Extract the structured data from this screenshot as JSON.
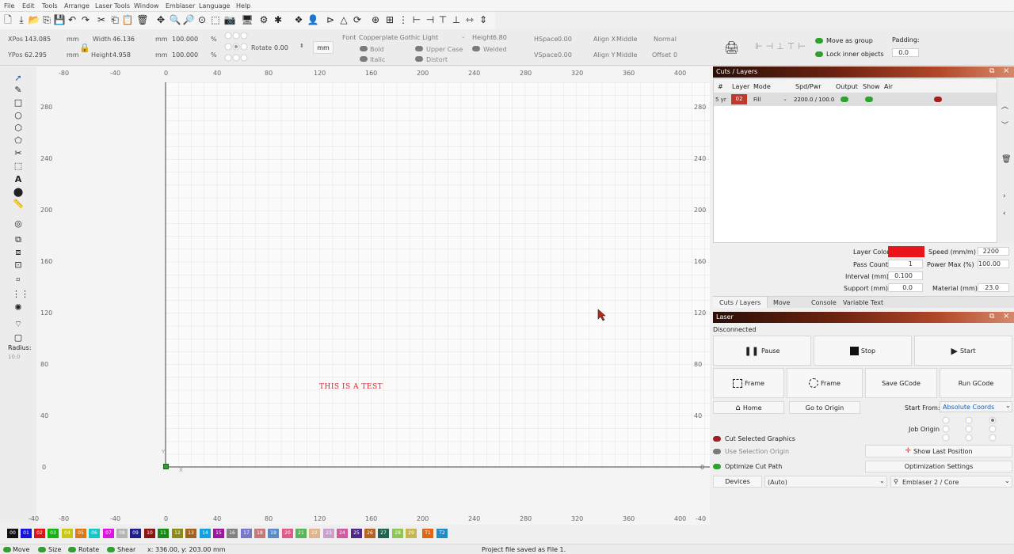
{
  "menu": [
    "File",
    "Edit",
    "Tools",
    "Arrange",
    "Laser Tools",
    "Window",
    "Emblaser",
    "Language",
    "Help"
  ],
  "props": {
    "xpos_label": "XPos",
    "xpos": "143.085",
    "ypos_label": "YPos",
    "ypos": "62.295",
    "unit": "mm",
    "width_label": "Width",
    "width": "46.136",
    "height_label": "Height",
    "height": "4.958",
    "scale_w": "100.000",
    "scale_h": "100.000",
    "pct": "%",
    "rotate_label": "Rotate",
    "rotate": "0.00",
    "mm_button": "mm",
    "font_label": "Font",
    "font_name": "Copperplate Gothic Light",
    "font_height_label": "Height",
    "font_height": "6.80",
    "bold": "Bold",
    "italic": "Italic",
    "upper_case": "Upper Case",
    "distort": "Distort",
    "welded": "Welded",
    "hspace_label": "HSpace",
    "hspace": "0.00",
    "vspace_label": "VSpace",
    "vspace": "0.00",
    "alignx_label": "Align X",
    "alignx": "Middle",
    "aligny_label": "Align Y",
    "aligny": "Middle",
    "mode": "Normal",
    "offset_label": "Offset",
    "offset": "0"
  },
  "rightbar": {
    "move_as_group": "Move as group",
    "lock_inner": "Lock inner objects",
    "padding_label": "Padding:",
    "padding": "0.0"
  },
  "tools": {
    "radius_label": "Radius:",
    "radius": "10.0"
  },
  "rulers": {
    "top": [
      "-80",
      "-40",
      "0",
      "40",
      "80",
      "120",
      "160",
      "200",
      "240",
      "280",
      "320",
      "360",
      "400"
    ],
    "left": [
      "280",
      "240",
      "200",
      "160",
      "120",
      "80",
      "40",
      "0",
      "-40"
    ]
  },
  "canvas": {
    "text": "THIS IS A TEST",
    "x_marker": "X",
    "y_marker": "Y"
  },
  "cuts": {
    "title": "Cuts / Layers",
    "headers": [
      "#",
      "Layer",
      "Mode",
      "Spd/Pwr",
      "Output",
      "Show",
      "Air"
    ],
    "row": {
      "num": "5 yr",
      "layer": "02",
      "mode": "Fill",
      "spdpwr": "2200.0 / 100.0"
    },
    "layer_color_label": "Layer Color",
    "layer_color": "#e8161b",
    "speed_label": "Speed (mm/m)",
    "speed": "2200",
    "pass_label": "Pass Count",
    "pass": "1",
    "power_label": "Power Max (%)",
    "power": "100.00",
    "interval_label": "Interval (mm)",
    "interval": "0.100",
    "support_label": "Support (mm)",
    "support": "0.0",
    "material_label": "Material (mm)",
    "material": "23.0",
    "tabs": [
      "Cuts / Layers",
      "Move",
      "Console",
      "Variable Text"
    ]
  },
  "laser": {
    "title": "Laser",
    "status": "Disconnected",
    "pause": "Pause",
    "stop": "Stop",
    "start": "Start",
    "frame1": "Frame",
    "frame2": "Frame",
    "save_gcode": "Save GCode",
    "run_gcode": "Run GCode",
    "home": "Home",
    "go_origin": "Go to Origin",
    "start_from_label": "Start From:",
    "start_from": "Absolute Coords",
    "job_origin_label": "Job Origin",
    "cut_selected": "Cut Selected Graphics",
    "use_selection": "Use Selection Origin",
    "show_last": "Show Last Position",
    "optimize_cut": "Optimize Cut Path",
    "optimization_settings": "Optimization Settings",
    "devices": "Devices",
    "device_port": "(Auto)",
    "device_name": "Emblaser 2 / Core"
  },
  "palette": [
    {
      "label": "00",
      "color": "#111111"
    },
    {
      "label": "01",
      "color": "#1414e0"
    },
    {
      "label": "02",
      "color": "#e01414"
    },
    {
      "label": "03",
      "color": "#14b414"
    },
    {
      "label": "04",
      "color": "#c8c814"
    },
    {
      "label": "05",
      "color": "#e07814"
    },
    {
      "label": "06",
      "color": "#14c8c8"
    },
    {
      "label": "07",
      "color": "#e014e0"
    },
    {
      "label": "08",
      "color": "#b4b4b4"
    },
    {
      "label": "09",
      "color": "#1e1e8c"
    },
    {
      "label": "10",
      "color": "#8c1414"
    },
    {
      "label": "11",
      "color": "#148c14"
    },
    {
      "label": "12",
      "color": "#8c8c14"
    },
    {
      "label": "13",
      "color": "#a0641e"
    },
    {
      "label": "14",
      "color": "#14a0e0"
    },
    {
      "label": "15",
      "color": "#a014a0"
    },
    {
      "label": "16",
      "color": "#828282"
    },
    {
      "label": "17",
      "color": "#7878c8"
    },
    {
      "label": "18",
      "color": "#c87878"
    },
    {
      "label": "19",
      "color": "#5a8cc8"
    },
    {
      "label": "20",
      "color": "#e05a8c"
    },
    {
      "label": "21",
      "color": "#5ab45a"
    },
    {
      "label": "22",
      "color": "#e0b48c"
    },
    {
      "label": "23",
      "color": "#c8a0c8"
    },
    {
      "label": "24",
      "color": "#d25aa0"
    },
    {
      "label": "25",
      "color": "#50288c"
    },
    {
      "label": "26",
      "color": "#b4641e"
    },
    {
      "label": "27",
      "color": "#1e6450"
    },
    {
      "label": "28",
      "color": "#8cc850"
    },
    {
      "label": "29",
      "color": "#c8b450"
    },
    {
      "label": "T1",
      "color": "#e06414"
    },
    {
      "label": "T2",
      "color": "#1e8cc8"
    }
  ],
  "status": {
    "move": "Move",
    "size": "Size",
    "rotate": "Rotate",
    "shear": "Shear",
    "coords": "x: 336.00, y: 203.00 mm",
    "message": "Project file saved as File 1."
  }
}
